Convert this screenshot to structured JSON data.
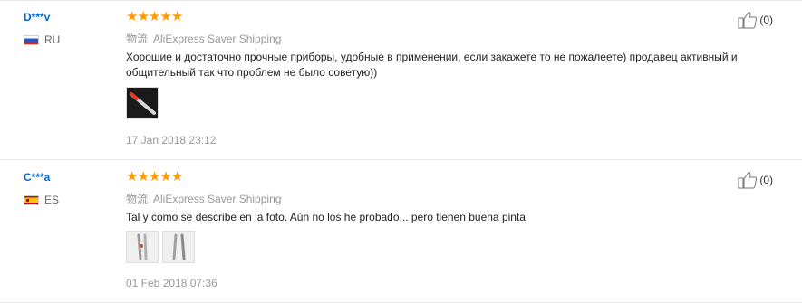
{
  "reviews": [
    {
      "user": "D***v",
      "country": "RU",
      "flag": "russia-flag",
      "rating": 5,
      "shipping_cn": "物流",
      "shipping": "AliExpress Saver Shipping",
      "text": "Хорошие и достаточно прочные приборы, удобные в применении, если закажете то не пожалеете) продавец активный и общительный так что проблем не было советую))",
      "photos": [
        "knife-photo"
      ],
      "date": "17 Jan 2018 23:12",
      "helpful_count": "(0)"
    },
    {
      "user": "C***a",
      "country": "ES",
      "flag": "spain-flag",
      "rating": 5,
      "shipping_cn": "物流",
      "shipping": "AliExpress Saver Shipping",
      "text": "Tal y como se describe en la foto. Aún no los he probado... pero tienen buena pinta",
      "photos": [
        "cutlery-photo-1",
        "cutlery-photo-2"
      ],
      "date": "01 Feb 2018 07:36",
      "helpful_count": "(0)"
    }
  ],
  "colors": {
    "star": "#ff9a00",
    "username": "#0066cc",
    "muted": "#999999"
  }
}
